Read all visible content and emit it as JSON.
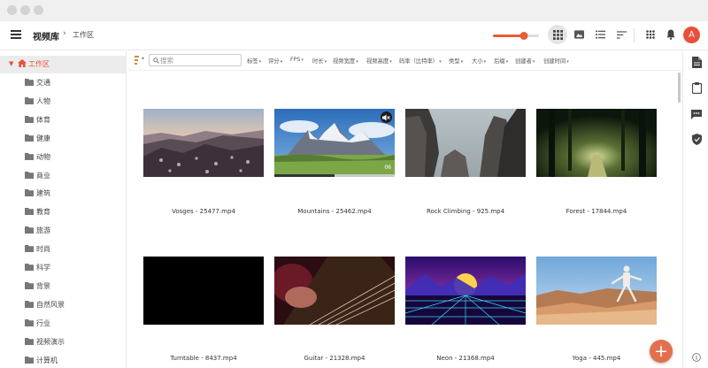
{
  "header": {
    "title": "视频库",
    "separator": "›",
    "current": "工作区",
    "thumb_size": 0.68,
    "user_initial": "A"
  },
  "sidebar": {
    "root": "工作区",
    "items": [
      "交通",
      "人物",
      "体育",
      "健康",
      "动物",
      "商业",
      "建筑",
      "教育",
      "旅游",
      "时尚",
      "科学",
      "背景",
      "自然风景",
      "行业",
      "视频演示",
      "计算机"
    ]
  },
  "filters": {
    "search_placeholder": "搜索",
    "labels": [
      "标签",
      "评分",
      "FPS",
      "时长",
      "视频宽度",
      "视频高度",
      "码率（比特率）",
      "类型",
      "大小",
      "后缀",
      "创建者",
      "创建时间"
    ]
  },
  "videos": [
    {
      "name": "Vosges - 25477.mp4",
      "scene": "snowy-forest"
    },
    {
      "name": "Mountains - 25462.mp4",
      "scene": "alpine-meadow",
      "badge": "06",
      "progress": 0.5,
      "muted": true
    },
    {
      "name": "Rock Climbing - 925.mp4",
      "scene": "rock-cliffs"
    },
    {
      "name": "Forest - 17844.mp4",
      "scene": "forest-path"
    },
    {
      "name": "Turntable - 8437.mp4",
      "scene": "black-frame"
    },
    {
      "name": "Guitar - 21328.mp4",
      "scene": "guitar-strings"
    },
    {
      "name": "Neon - 21368.mp4",
      "scene": "neon-grid"
    },
    {
      "name": "Yoga - 445.mp4",
      "scene": "yoga-cliff"
    }
  ],
  "colors": {
    "accent": "#e8503a",
    "fab": "#e2704f",
    "slider": "#e85c36"
  }
}
